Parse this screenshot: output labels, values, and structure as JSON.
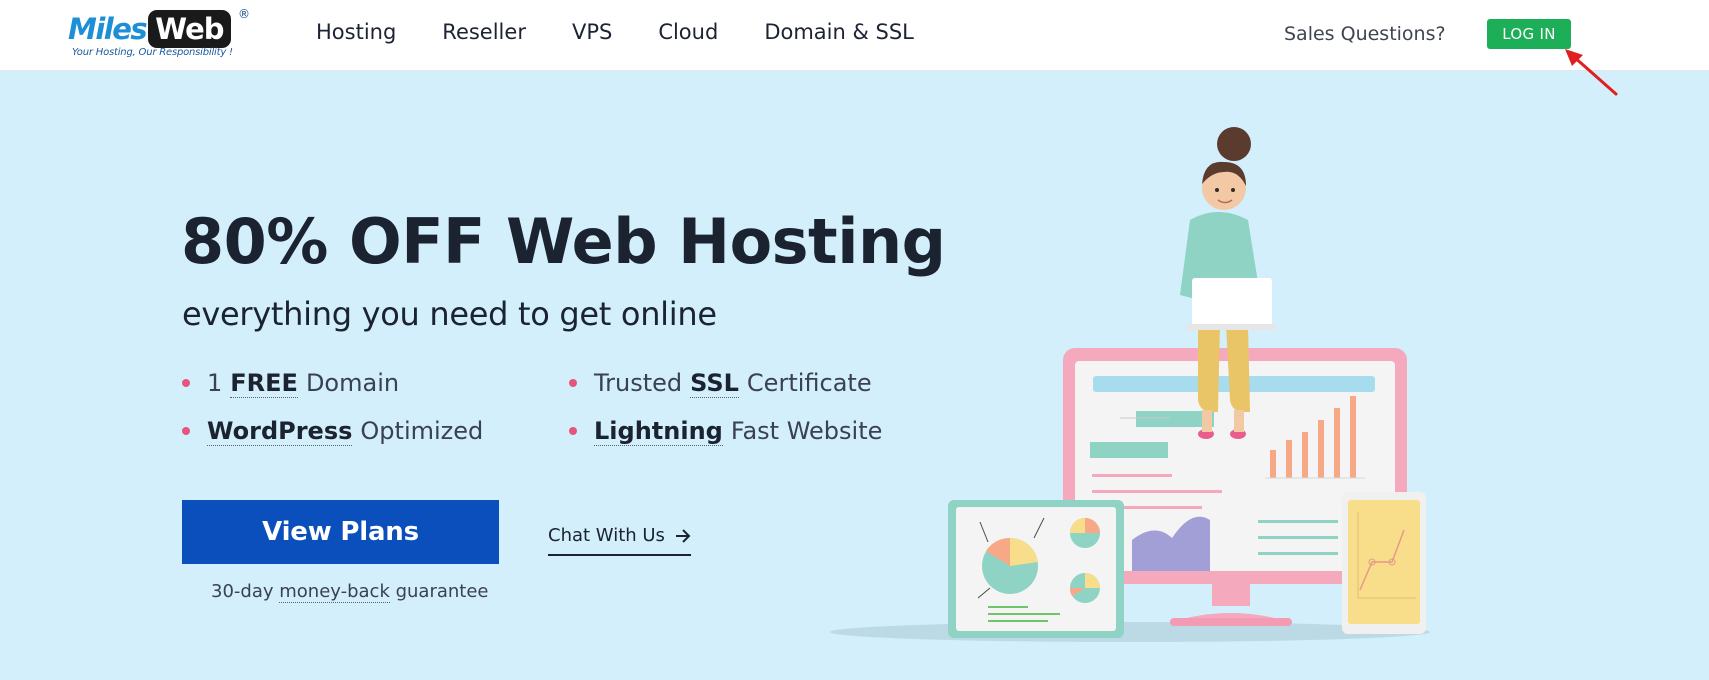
{
  "brand": {
    "name_part1": "Miles",
    "name_part2": "Web",
    "registered": "®",
    "tagline": "Your Hosting, Our Responsibility !"
  },
  "nav": {
    "items": [
      {
        "label": "Hosting"
      },
      {
        "label": "Reseller"
      },
      {
        "label": "VPS"
      },
      {
        "label": "Cloud"
      },
      {
        "label": "Domain & SSL"
      }
    ],
    "sales_label": "Sales Questions?",
    "login_label": "LOG IN"
  },
  "hero": {
    "title": "80% OFF Web Hosting",
    "subtitle": "everything you need to get online",
    "features": [
      {
        "lead": "1",
        "strong": "FREE",
        "rest": "Domain"
      },
      {
        "lead": "Trusted",
        "strong": "SSL",
        "rest": "Certificate"
      },
      {
        "lead": "",
        "strong": "WordPress",
        "rest": "Optimized"
      },
      {
        "lead": "",
        "strong": "Lightning",
        "rest": "Fast Website"
      }
    ],
    "view_plans_label": "View Plans",
    "guarantee_prefix": "30-day ",
    "guarantee_link": "money-back",
    "guarantee_suffix": " guarantee",
    "chat_label": "Chat With Us"
  },
  "icons": {
    "chat_arrow": "arrow-right-icon",
    "annotation": "red-arrow-icon"
  },
  "colors": {
    "background": "#d3effb",
    "login_green": "#1dae58",
    "view_plans_blue": "#0a4fbb",
    "bullet_pink": "#e3577c",
    "brand_blue": "#1c8fd6"
  }
}
